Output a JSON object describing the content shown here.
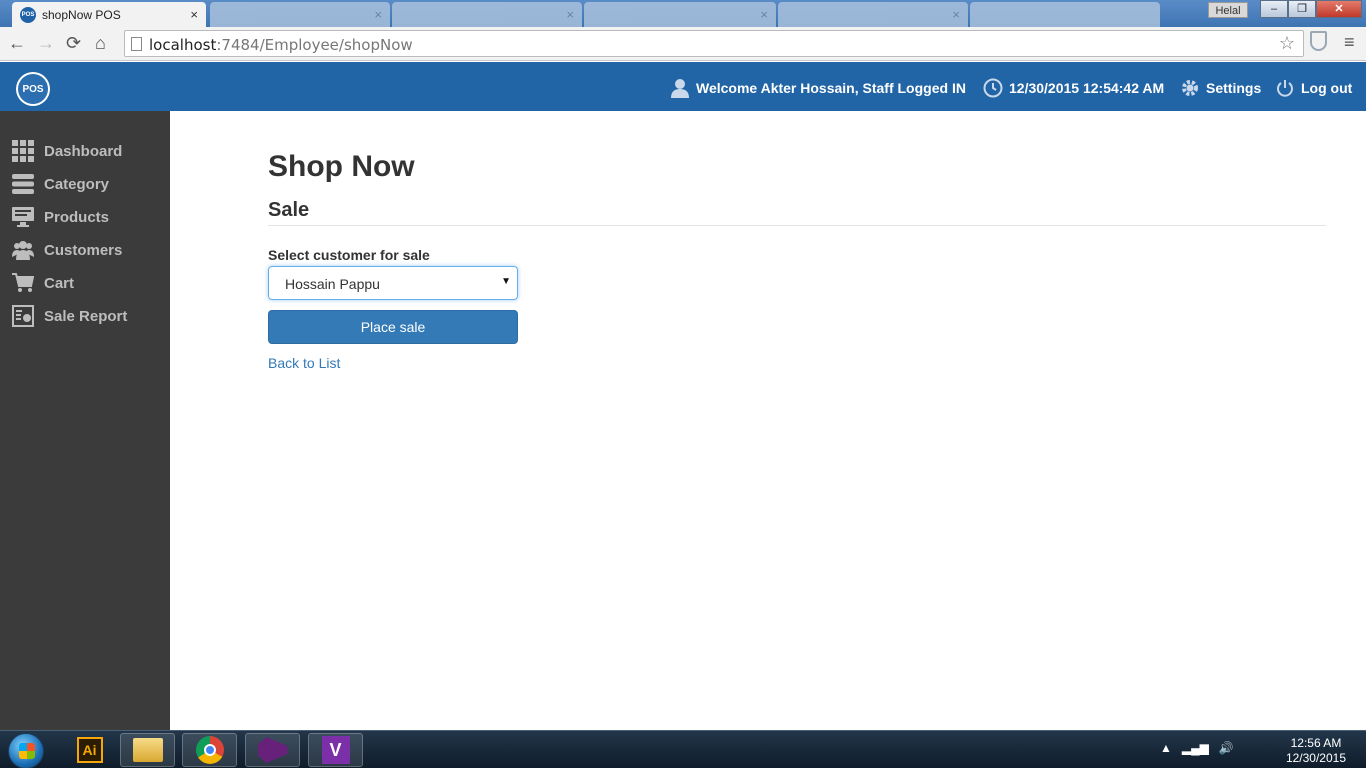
{
  "browser": {
    "active_tab_title": "shopNow POS",
    "favicon_text": "POS",
    "close_glyph": "×",
    "user_badge": "Helal",
    "url_host": "localhost",
    "url_path": ":7484/Employee/shopNow",
    "win_min": "–",
    "win_max": "❐",
    "win_close": "✕",
    "back_glyph": "←",
    "forward_glyph": "→",
    "reload_glyph": "⟳",
    "home_glyph": "⌂",
    "star_glyph": "☆",
    "menu_glyph": "≡"
  },
  "header": {
    "logo_text": "POS",
    "welcome": "Welcome Akter Hossain, Staff Logged IN",
    "datetime": "12/30/2015 12:54:42 AM",
    "settings": "Settings",
    "logout": "Log out"
  },
  "sidebar": {
    "items": [
      {
        "label": "Dashboard",
        "icon": "grid-icon"
      },
      {
        "label": "Category",
        "icon": "server-stack-icon"
      },
      {
        "label": "Products",
        "icon": "monitor-icon"
      },
      {
        "label": "Customers",
        "icon": "users-icon"
      },
      {
        "label": "Cart",
        "icon": "cart-icon"
      },
      {
        "label": "Sale Report",
        "icon": "report-icon"
      }
    ]
  },
  "main": {
    "title": "Shop Now",
    "subtitle": "Sale",
    "customer_label": "Select customer for sale",
    "customer_selected": "Hossain Pappu",
    "select_caret": "▼",
    "place_sale": "Place sale",
    "back_link": "Back to List"
  },
  "taskbar": {
    "ai_label": "Ai",
    "vs_label": "V",
    "time": "12:56 AM",
    "date": "12/30/2015",
    "tray_up": "▲",
    "tray_signal": "▂▄▆",
    "tray_volume": "🔊"
  },
  "colors": {
    "header_bg": "#2265a6",
    "sidebar_bg": "#3b3b3b",
    "primary": "#337ab7"
  }
}
